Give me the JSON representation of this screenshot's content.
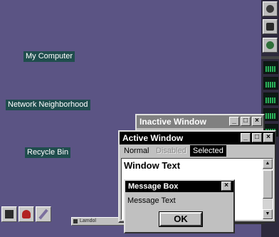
{
  "desktop": {
    "icons": [
      {
        "label": "My Computer"
      },
      {
        "label": "Network Neighborhood"
      },
      {
        "label": "Recycle Bin"
      }
    ]
  },
  "taskbar_window": {
    "label": "Lamdol"
  },
  "inactive_window": {
    "title": "Inactive Window",
    "buttons": [
      "minimize-icon",
      "maximize-icon",
      "close-icon"
    ]
  },
  "active_window": {
    "title": "Active Window",
    "buttons": [
      "minimize-icon",
      "maximize-icon",
      "close-icon"
    ],
    "menu": {
      "normal": "Normal",
      "disabled": "Disabled",
      "selected": "Selected"
    },
    "window_text": "Window Text"
  },
  "message_box": {
    "title": "Message Box",
    "text": "Message Text",
    "ok_label": "OK"
  },
  "glyphs": {
    "minimize": "_",
    "maximize": "□",
    "close": "×",
    "up": "▲",
    "down": "▼"
  },
  "colors": {
    "desktop": "#5b5484",
    "icon_label_bg": "#1f4d4d",
    "active_title": "#000000",
    "inactive_title": "#808080",
    "face": "#c0c0c0"
  }
}
